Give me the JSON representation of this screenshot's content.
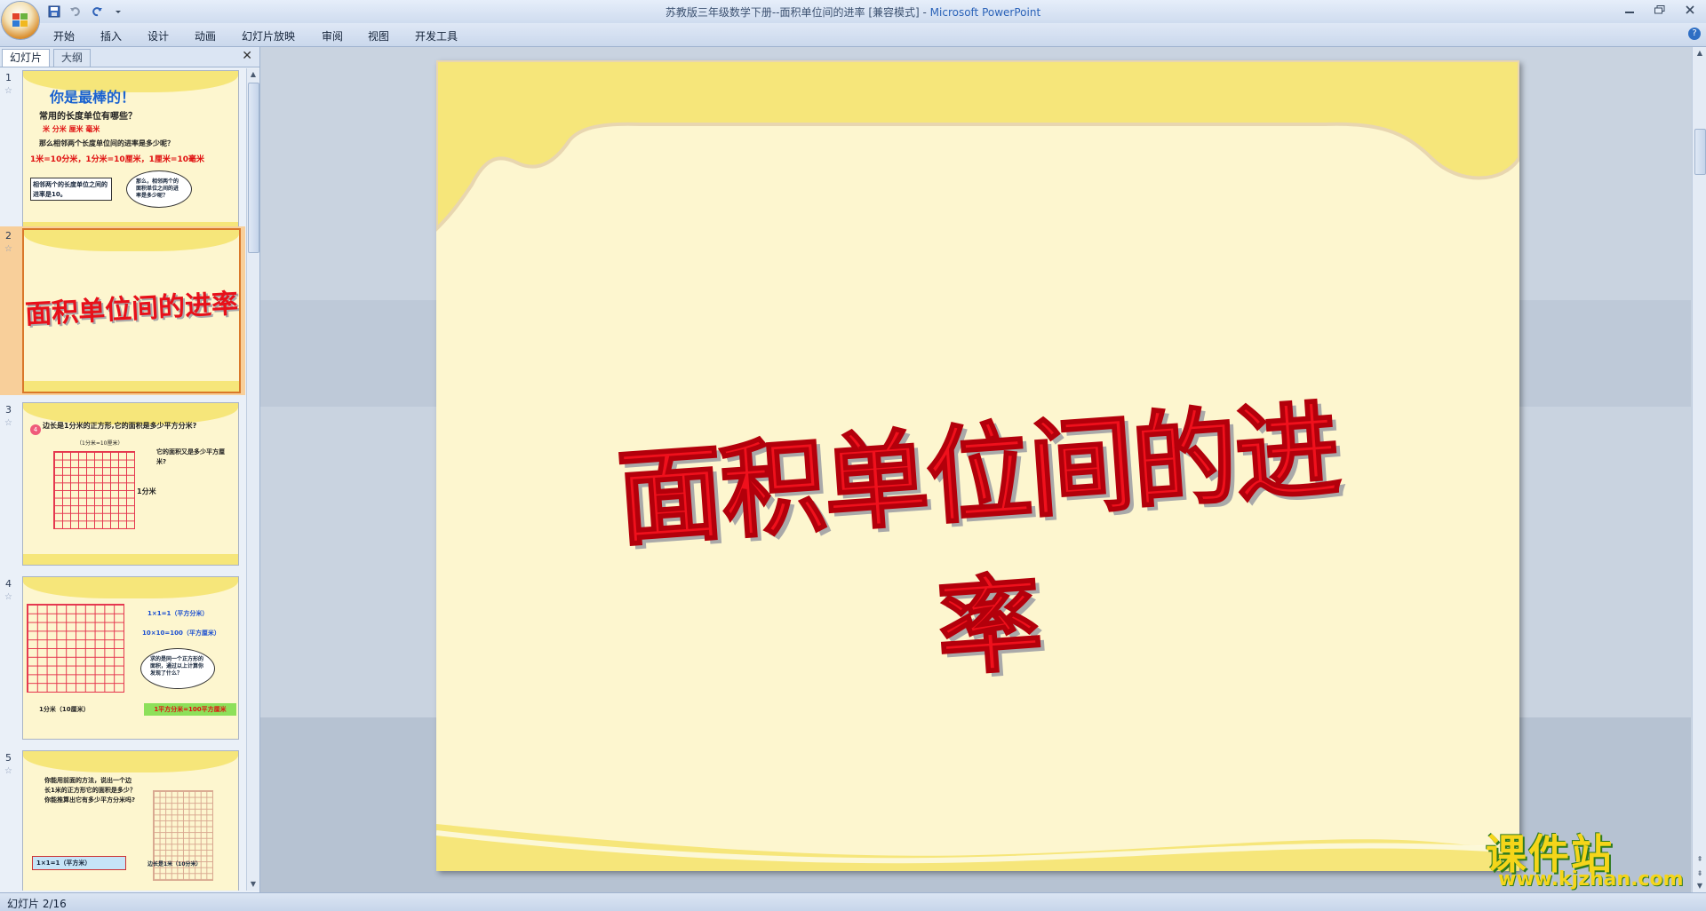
{
  "window": {
    "title": "苏教版三年级数学下册--面积单位间的进率 [兼容模式] - ",
    "app_name": "Microsoft PowerPoint"
  },
  "ribbon_tabs": [
    "开始",
    "插入",
    "设计",
    "动画",
    "幻灯片放映",
    "审阅",
    "视图",
    "开发工具"
  ],
  "left_panel": {
    "tabs": [
      "幻灯片",
      "大纲"
    ],
    "active_tab": "幻灯片",
    "close_glyph": "✕"
  },
  "thumbnails": [
    {
      "number": "1",
      "title": "你是最棒的！",
      "question": "常用的长度单位有哪些？",
      "units": "米  分米  厘米  毫米",
      "ask": "那么相邻两个长度单位间的进率是多少呢？",
      "rate": "1米=10分米，1分米=10厘米，1厘米=10毫米",
      "box": "相邻两个的长度单位之间的进率是10。",
      "cloud": "那么，相邻两个的面积单位之间的进率是多少呢？"
    },
    {
      "number": "2",
      "title": "面积单位间的进率"
    },
    {
      "number": "3",
      "badge": "4",
      "head": "边长是1分米的正方形,它的面积是多少平方分米?",
      "sub": "（1分米=10厘米）",
      "side": "它的面积又是多少平方厘米?",
      "length": "1分米"
    },
    {
      "number": "4",
      "eq1": "1×1=1（平方分米）",
      "eq2": "10×10=100（平方厘米）",
      "cloud": "求的是同一个正方形的面积，通过以上计算你发现了什么？",
      "bottom": "1分米（10厘米）",
      "result": "1平方分米=100平方厘米"
    },
    {
      "number": "5",
      "text": "你能用前面的方法，说出一个边长1米的正方形它的面积是多少？你能推算出它有多少平方分米吗?",
      "eq": "1×1=1（平方米）",
      "note": "边长是1米（10分米）"
    }
  ],
  "slide": {
    "title": "面积单位间的进率",
    "colors": {
      "background": "#fdf6cf",
      "band": "#f6e67a",
      "title": "#f0101c"
    }
  },
  "watermark": {
    "name": "课件站",
    "url": "www.kjzhan.com"
  },
  "status": {
    "slide_info": "幻灯片 2/16"
  }
}
